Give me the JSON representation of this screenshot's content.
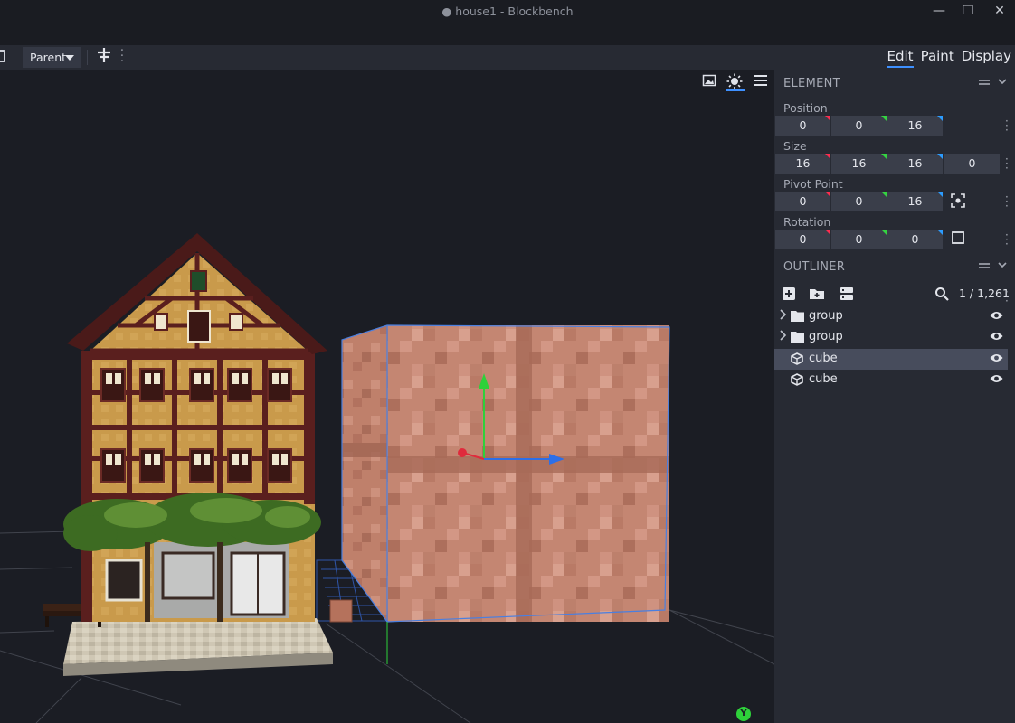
{
  "window": {
    "title": "● house1 - Blockbench",
    "minimize_label": "—",
    "restore_label": "❐",
    "close_label": "✕"
  },
  "toolbar": {
    "space_select": "Parent",
    "tool_icon": "move-pivot-icon"
  },
  "mode_tabs": [
    {
      "label": "Edit",
      "active": true
    },
    {
      "label": "Paint",
      "active": false
    },
    {
      "label": "Display",
      "active": false
    }
  ],
  "viewport": {
    "gizmo_axis_label": "Y",
    "icons": [
      "background-image-icon",
      "lighting-icon",
      "menu-icon"
    ]
  },
  "element_panel": {
    "title": "ELEMENT",
    "position": {
      "label": "Position",
      "values": [
        "0",
        "0",
        "16"
      ]
    },
    "size": {
      "label": "Size",
      "values": [
        "16",
        "16",
        "16"
      ],
      "inflate": "0"
    },
    "pivot": {
      "label": "Pivot Point",
      "values": [
        "0",
        "0",
        "16"
      ]
    },
    "rotation": {
      "label": "Rotation",
      "values": [
        "0",
        "0",
        "0"
      ]
    }
  },
  "outliner": {
    "title": "OUTLINER",
    "count": "1 / 1,261",
    "items": [
      {
        "label": "group",
        "type": "group",
        "selected": false
      },
      {
        "label": "group",
        "type": "group",
        "selected": false
      },
      {
        "label": "cube",
        "type": "cube",
        "selected": true
      },
      {
        "label": "cube",
        "type": "cube",
        "selected": false
      }
    ]
  },
  "colors": {
    "accent": "#3e90ff",
    "axis_x": "#ff2c4f",
    "axis_y": "#34d441",
    "axis_z": "#2c9cff",
    "panel_bg": "#272a33",
    "viewport_bg": "#1b1d24"
  }
}
